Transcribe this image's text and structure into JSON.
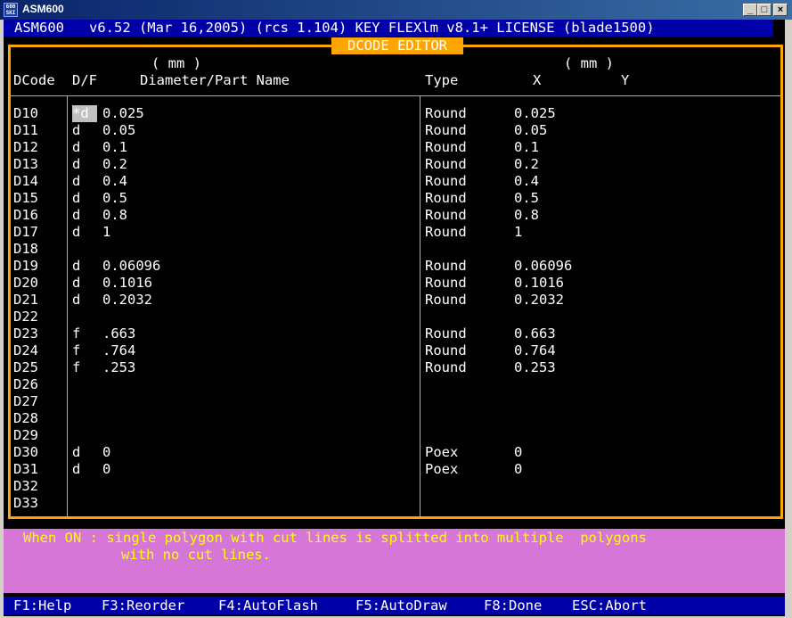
{
  "window": {
    "title": "ASM600",
    "icon_text": "600\nSKI"
  },
  "info_bar": "ASM600   v6.52 (Mar 16,2005) (rcs 1.104) KEY FLEXlm v8.1+ LICENSE (blade1500)",
  "editor": {
    "title": "DCODE EDITOR",
    "headers": {
      "unit_left": "( mm )",
      "unit_right": "( mm )",
      "dcode": "DCode",
      "df": "D/F",
      "name": "Diameter/Part Name",
      "type": "Type",
      "x": "X",
      "y": "Y"
    },
    "rows": [
      {
        "dcode": "D10",
        "df": "*d",
        "name": "0.025",
        "type": "Round",
        "x": "0.025"
      },
      {
        "dcode": "D11",
        "df": "d",
        "name": "0.05",
        "type": "Round",
        "x": "0.05"
      },
      {
        "dcode": "D12",
        "df": "d",
        "name": "0.1",
        "type": "Round",
        "x": "0.1"
      },
      {
        "dcode": "D13",
        "df": "d",
        "name": "0.2",
        "type": "Round",
        "x": "0.2"
      },
      {
        "dcode": "D14",
        "df": "d",
        "name": "0.4",
        "type": "Round",
        "x": "0.4"
      },
      {
        "dcode": "D15",
        "df": "d",
        "name": "0.5",
        "type": "Round",
        "x": "0.5"
      },
      {
        "dcode": "D16",
        "df": "d",
        "name": "0.8",
        "type": "Round",
        "x": "0.8"
      },
      {
        "dcode": "D17",
        "df": "d",
        "name": "1",
        "type": "Round",
        "x": "1"
      },
      {
        "dcode": "D18",
        "df": "",
        "name": "",
        "type": "",
        "x": ""
      },
      {
        "dcode": "D19",
        "df": "d",
        "name": "0.06096",
        "type": "Round",
        "x": "0.06096"
      },
      {
        "dcode": "D20",
        "df": "d",
        "name": "0.1016",
        "type": "Round",
        "x": "0.1016"
      },
      {
        "dcode": "D21",
        "df": "d",
        "name": "0.2032",
        "type": "Round",
        "x": "0.2032"
      },
      {
        "dcode": "D22",
        "df": "",
        "name": "",
        "type": "",
        "x": ""
      },
      {
        "dcode": "D23",
        "df": "f",
        "name": ".663",
        "type": "Round",
        "x": "0.663"
      },
      {
        "dcode": "D24",
        "df": "f",
        "name": ".764",
        "type": "Round",
        "x": "0.764"
      },
      {
        "dcode": "D25",
        "df": "f",
        "name": ".253",
        "type": "Round",
        "x": "0.253"
      },
      {
        "dcode": "D26",
        "df": "",
        "name": "",
        "type": "",
        "x": ""
      },
      {
        "dcode": "D27",
        "df": "",
        "name": "",
        "type": "",
        "x": ""
      },
      {
        "dcode": "D28",
        "df": "",
        "name": "",
        "type": "",
        "x": ""
      },
      {
        "dcode": "D29",
        "df": "",
        "name": "",
        "type": "",
        "x": ""
      },
      {
        "dcode": "D30",
        "df": "d",
        "name": "0",
        "type": "Poex",
        "x": "0"
      },
      {
        "dcode": "D31",
        "df": "d",
        "name": "0",
        "type": "Poex",
        "x": "0"
      },
      {
        "dcode": "D32",
        "df": "",
        "name": "",
        "type": "",
        "x": ""
      },
      {
        "dcode": "D33",
        "df": "",
        "name": "",
        "type": "",
        "x": ""
      }
    ]
  },
  "message": {
    "line1": "When ON : single polygon with cut lines is splitted into multiple  polygons",
    "line2": "with no cut lines."
  },
  "function_keys": [
    "F1:Help",
    "F3:Reorder",
    "F4:AutoFlash",
    "F5:AutoDraw",
    "F8:Done",
    "ESC:Abort"
  ],
  "colors": {
    "frame": "#ffa500",
    "info_bar": "#0000a8",
    "message_bg": "#d676d6",
    "message_text": "#ffff00"
  }
}
